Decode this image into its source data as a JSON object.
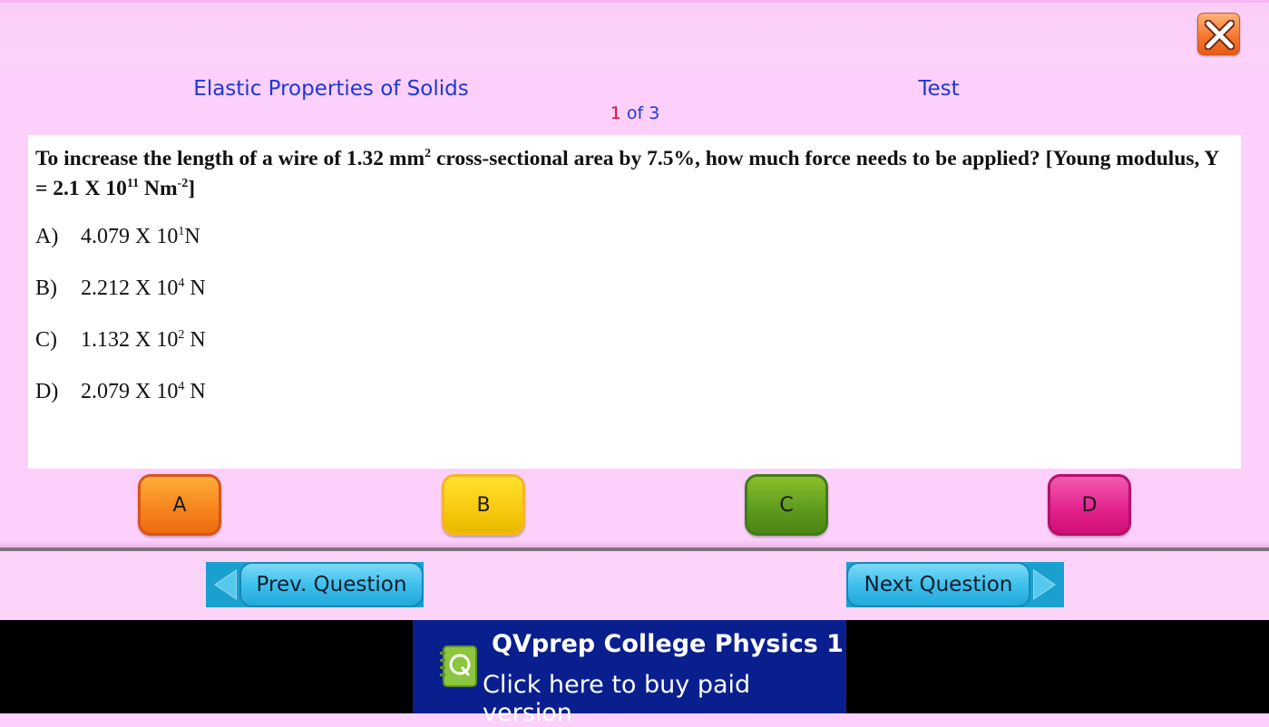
{
  "header": {
    "subject": "Elastic Properties of Solids",
    "mode": "Test",
    "counter_current": "1",
    "counter_rest": " of 3",
    "close_icon": "close-icon"
  },
  "question": {
    "part1": "To increase the length of a wire of 1.32 mm",
    "sup1": "2",
    "part2": " cross-sectional area by 7.5%, how much force needs to be applied?  [Young modulus, Y = 2.1 X 10",
    "sup2": "11",
    "part3": " Nm",
    "sup3": "-2",
    "part4": "]"
  },
  "options": [
    {
      "letter": "A)",
      "text": "4.079 X 10",
      "exp": "1",
      "unit": "N"
    },
    {
      "letter": "B)",
      "text": "2.212 X 10",
      "exp": "4",
      "unit": " N"
    },
    {
      "letter": "C)",
      "text": "1.132 X 10",
      "exp": "2",
      "unit": " N"
    },
    {
      "letter": "D)",
      "text": "2.079 X 10",
      "exp": "4",
      "unit": " N"
    }
  ],
  "answer_buttons": {
    "a": "A",
    "b": "B",
    "c": "C",
    "d": "D",
    "colors": {
      "a": "#f5821c",
      "b": "#f8c910",
      "c": "#5d9a1e",
      "d": "#e2208c"
    }
  },
  "nav": {
    "prev_label": "Prev. Question",
    "next_label": "Next Question",
    "prev_icon": "arrow-left-icon",
    "next_icon": "arrow-right-icon"
  },
  "ad": {
    "title": "QVprep College Physics 1",
    "subtitle": "Click here to buy paid version",
    "logo_icon": "qvprep-logo-icon"
  },
  "colors": {
    "background": "#fdd0fb",
    "title_blue": "#1f37d6",
    "counter_red": "#d8102a",
    "nav_blue": "#22a9db",
    "ad_blue": "#0a1f8e"
  }
}
